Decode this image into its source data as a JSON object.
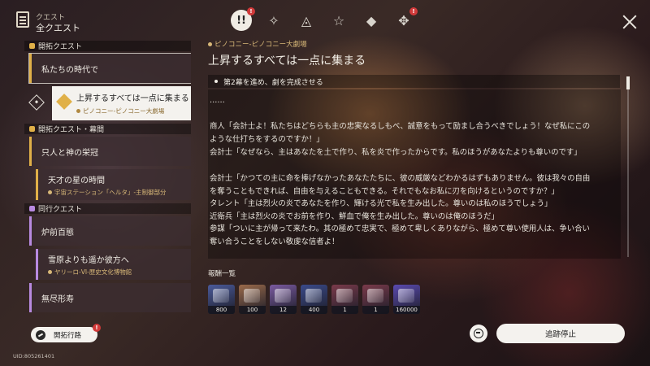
{
  "header": {
    "section_label": "クエスト",
    "title": "全クエスト",
    "tabs": [
      {
        "name": "tab-all",
        "icon": "!!",
        "badge": "!"
      },
      {
        "name": "tab-trailblaze",
        "icon": "✧",
        "badge": ""
      },
      {
        "name": "tab-adventure",
        "icon": "◬",
        "badge": ""
      },
      {
        "name": "tab-companion",
        "icon": "☆",
        "badge": ""
      },
      {
        "name": "tab-daily",
        "icon": "◆",
        "badge": ""
      },
      {
        "name": "tab-event",
        "icon": "✥",
        "badge": "!"
      }
    ]
  },
  "sidebar": {
    "categories": [
      {
        "label": "開拓クエスト",
        "color": "#e0b048",
        "items": [
          {
            "title": "私たちの時代で",
            "location": ""
          },
          {
            "title": "上昇するすべては一点に集まる",
            "location": "ピノコニー-ピノコニー大劇場"
          }
        ]
      },
      {
        "label": "開拓クエスト・幕間",
        "color": "#e0b048",
        "items": [
          {
            "title": "只人と神の栄冠",
            "location": ""
          },
          {
            "title": "天才の星の時間",
            "location": "宇宙ステーション「ヘルタ」-主制御部分"
          }
        ]
      },
      {
        "label": "同行クエスト",
        "color": "#b88ae0",
        "items": [
          {
            "title": "炉前百態",
            "location": ""
          },
          {
            "title": "雪原よりも遥か彼方へ",
            "location": "ヤリーロ-VI-歴史文化博物館"
          },
          {
            "title": "無尽形寿",
            "location": ""
          }
        ]
      }
    ]
  },
  "detail": {
    "location": "ピノコニー-ピノコニー大劇場",
    "title": "上昇するすべては一点に集まる",
    "objective": "第2幕を進め、劇を完成させる",
    "lines": [
      "……",
      "",
      "商人「会計士よ！私たちはどちらも主の忠実なるしもべ、誠意をもって励まし合うべきでしょう！なぜ私にこの",
      "ような仕打ちをするのですか！」",
      "会計士「なぜなら、主はあなたを土で作り、私を炎で作ったからです。私のほうがあなたよりも尊いのです」",
      "",
      "会計士「かつての主に命を捧げなかったあなたたちに、彼の威厳などわかるはずもありません。彼は我々の自由",
      "を奪うこともできれば、自由を与えることもできる。それでもなお私に刃を向けるというのですか？」",
      "タレント「主は烈火の炎であなたを作り、輝ける光で私を生み出した。尊いのは私のほうでしょう」",
      "近衛兵「主は烈火の炎でお前を作り、鮮血で俺を生み出した。尊いのは俺のほうだ」",
      "参謀「ついに主が帰って来たわ。其の極めて忠実で、極めて卑しくありながら、極めて尊い使用人は、争い合い",
      "奪い合うことをしない敬虔な信者よ！"
    ],
    "reward_label": "報酬一覧",
    "rewards": [
      {
        "icon": "exp-scroll-icon",
        "qty": "800",
        "color": "#4a5a9a"
      },
      {
        "icon": "feather-icon",
        "qty": "100",
        "color": "#9a6a4a"
      },
      {
        "icon": "book-icon",
        "qty": "12",
        "color": "#7a5aa0"
      },
      {
        "icon": "credit-icon",
        "qty": "400",
        "color": "#3a4a8a"
      },
      {
        "icon": "material-book-icon",
        "qty": "1",
        "color": "#7a3a4a"
      },
      {
        "icon": "material-book-icon",
        "qty": "1",
        "color": "#7a3a4a"
      },
      {
        "icon": "exp-material-icon",
        "qty": "160000",
        "color": "#5a4ab0"
      }
    ]
  },
  "footer": {
    "path_button": "開拓行路",
    "path_badge": "!",
    "uid": "UID:805261401",
    "stop_button": "追跡停止"
  }
}
